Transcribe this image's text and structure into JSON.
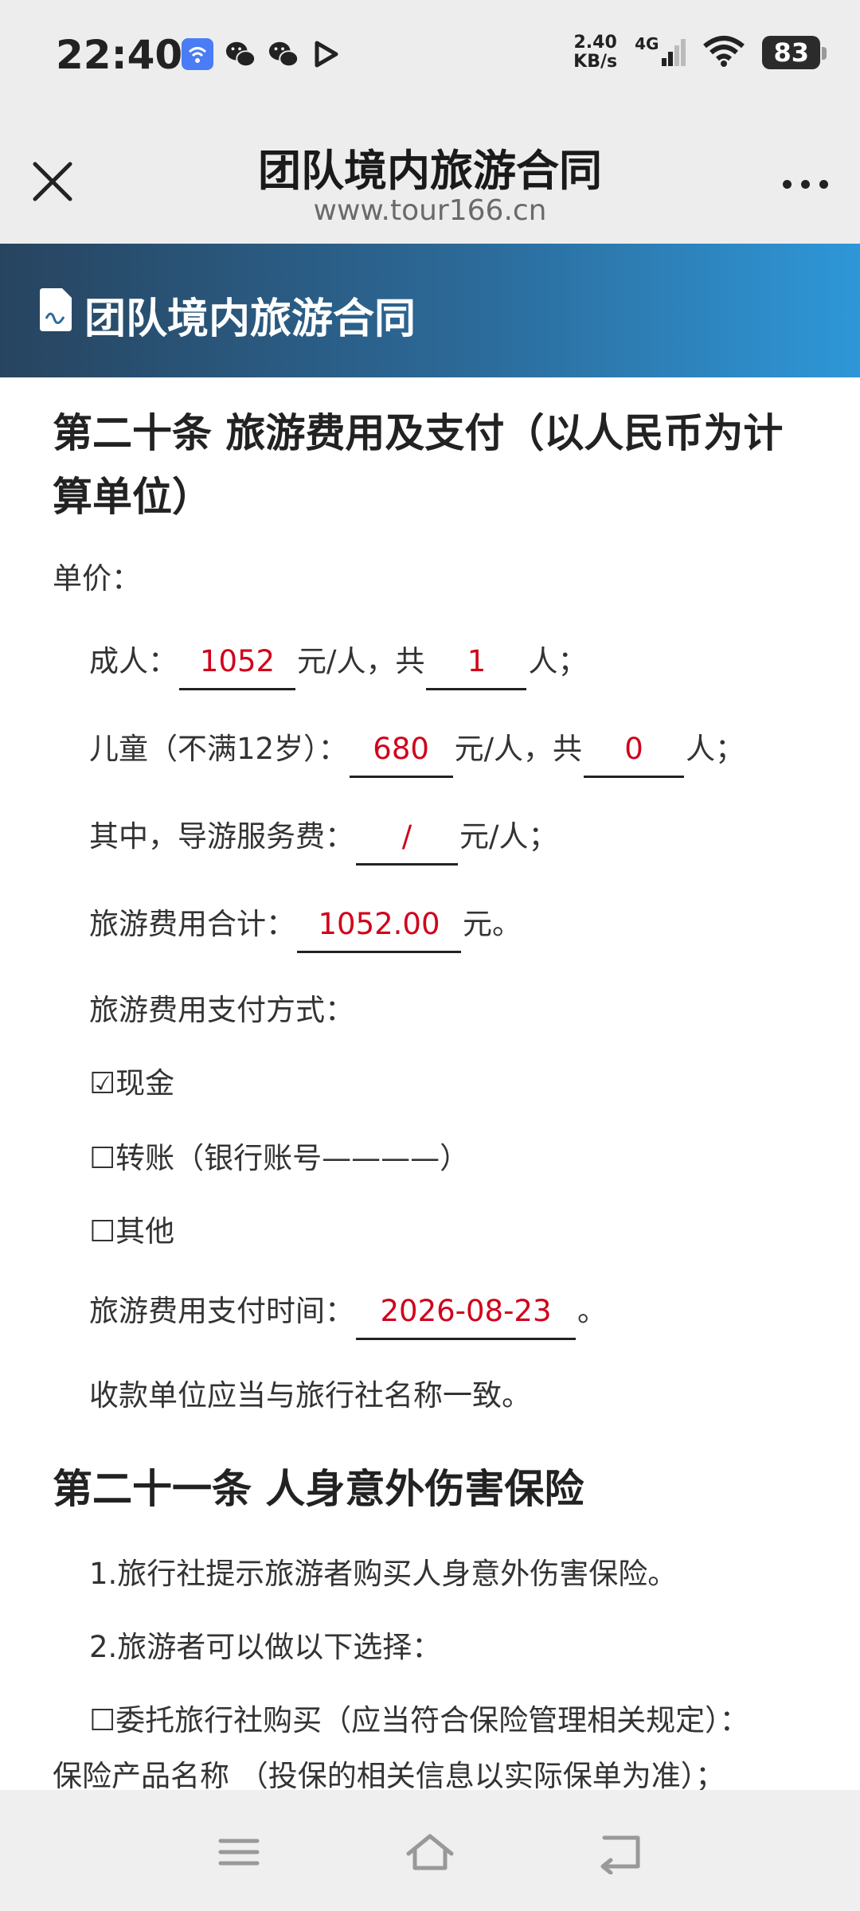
{
  "status": {
    "time": "22:40",
    "speed_value": "2.40",
    "speed_unit": "KB/s",
    "network": "4G",
    "battery": "83"
  },
  "header": {
    "title": "团队境内旅游合同",
    "url": "www.tour166.cn"
  },
  "banner": {
    "title": "团队境内旅游合同"
  },
  "article20": {
    "title": "第二十条 旅游费用及支付（以人民币为计算单位）",
    "unit_price_label": "单价：",
    "adult_label": "成人：",
    "adult_price": "1052",
    "per_person_total": "元/人，共",
    "adult_count": "1",
    "persons_end": "人；",
    "child_label": "儿童（不满12岁）：",
    "child_price": "680",
    "child_count": "0",
    "guide_fee_label": "其中，导游服务费：",
    "guide_fee": "/",
    "guide_fee_unit": "元/人；",
    "total_label": "旅游费用合计：",
    "total_value": "1052.00",
    "total_unit": "元。",
    "payment_method_label": "旅游费用支付方式：",
    "opt_cash": "☑现金",
    "opt_transfer": "☐转账（银行账号————）",
    "opt_other": "☐其他",
    "payment_time_label": "旅游费用支付时间：",
    "payment_time": "2026-08-23",
    "payment_time_end": "。",
    "payee_note": "收款单位应当与旅行社名称一致。"
  },
  "article21": {
    "title": "第二十一条 人身意外伤害保险",
    "item1": "1.旅行社提示旅游者购买人身意外伤害保险。",
    "item2": "2.旅游者可以做以下选择：",
    "item3_line1": "☐委托旅行社购买（应当符合保险管理相关规定）：",
    "item3_line2": "保险产品名称 （投保的相关信息以实际保单为准）；"
  },
  "icons": [
    "wifi-app-icon",
    "wechat-icon",
    "wechat-icon",
    "play-icon",
    "signal-icon",
    "wifi-icon",
    "close-icon",
    "more-icon",
    "document-icon",
    "menu-icon",
    "home-icon",
    "back-icon"
  ]
}
